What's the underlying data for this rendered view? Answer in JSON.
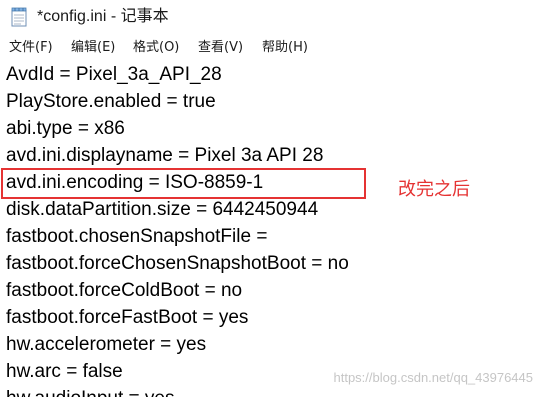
{
  "window": {
    "title": "*config.ini - 记事本",
    "icon": "notepad-icon"
  },
  "menu": {
    "items": [
      {
        "label": "文件(F)"
      },
      {
        "label": "编辑(E)"
      },
      {
        "label": "格式(O)"
      },
      {
        "label": "查看(V)"
      },
      {
        "label": "帮助(H)"
      }
    ]
  },
  "editor": {
    "lines": [
      {
        "text": "AvdId = Pixel_3a_API_28"
      },
      {
        "text": "PlayStore.enabled = true"
      },
      {
        "text": "abi.type = x86"
      },
      {
        "text": "avd.ini.displayname = Pixel 3a API 28"
      },
      {
        "text": "avd.ini.encoding = ISO-8859-1"
      },
      {
        "text": "disk.dataPartition.size = 6442450944"
      },
      {
        "text": "fastboot.chosenSnapshotFile = "
      },
      {
        "text": "fastboot.forceChosenSnapshotBoot = no"
      },
      {
        "text": "fastboot.forceColdBoot = no"
      },
      {
        "text": "fastboot.forceFastBoot = yes"
      },
      {
        "text": "hw.accelerometer = yes"
      },
      {
        "text": "hw.arc = false"
      },
      {
        "text": "hw.audioInput = yes"
      }
    ],
    "highlight_color": "#e53333"
  },
  "annotation": {
    "text": "改完之后",
    "color": "#e53333"
  },
  "watermark": {
    "text": "https://blog.csdn.net/qq_43976445"
  }
}
